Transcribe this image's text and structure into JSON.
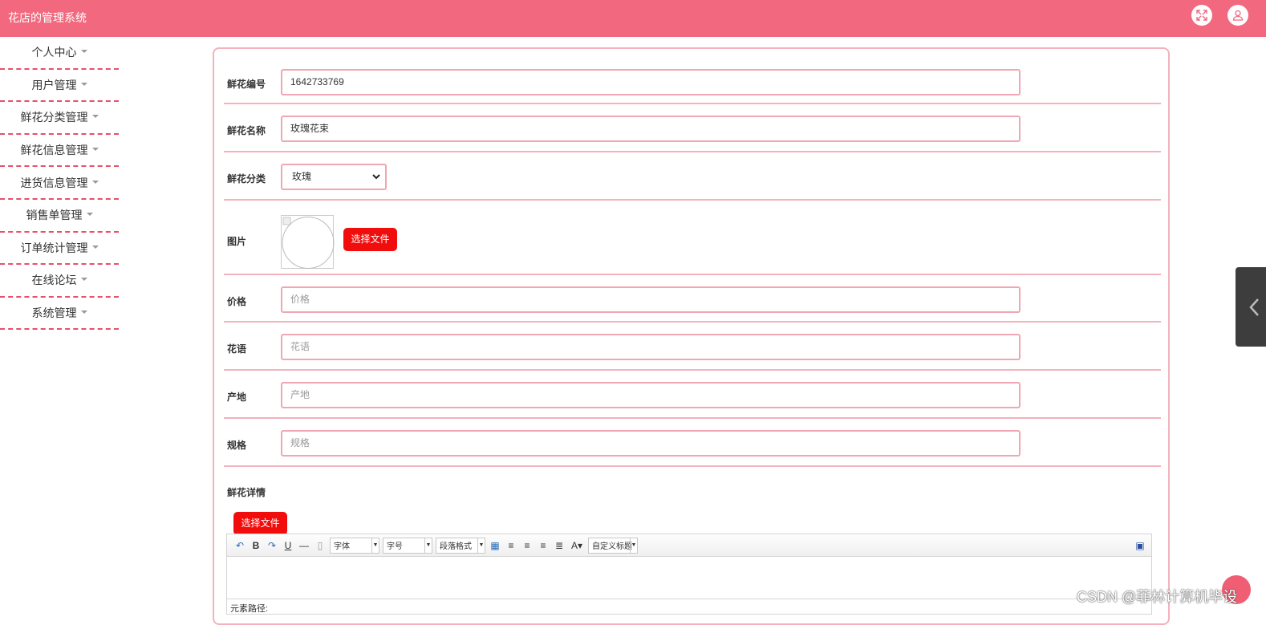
{
  "header": {
    "title": "花店的管理系统",
    "expand_icon": "fullscreen-icon",
    "user_icon": "user-icon"
  },
  "sidebar": {
    "items": [
      {
        "label": "个人中心"
      },
      {
        "label": "用户管理"
      },
      {
        "label": "鲜花分类管理"
      },
      {
        "label": "鲜花信息管理"
      },
      {
        "label": "进货信息管理"
      },
      {
        "label": "销售单管理"
      },
      {
        "label": "订单统计管理"
      },
      {
        "label": "在线论坛"
      },
      {
        "label": "系统管理"
      }
    ]
  },
  "form": {
    "code": {
      "label": "鲜花编号",
      "value": "1642733769"
    },
    "name": {
      "label": "鲜花名称",
      "value": "玫瑰花束"
    },
    "category": {
      "label": "鲜花分类",
      "selected": "玫瑰"
    },
    "image": {
      "label": "图片",
      "button": "选择文件"
    },
    "price": {
      "label": "价格",
      "placeholder": "价格"
    },
    "language": {
      "label": "花语",
      "placeholder": "花语"
    },
    "origin": {
      "label": "产地",
      "placeholder": "产地"
    },
    "spec": {
      "label": "规格",
      "placeholder": "规格"
    },
    "detail": {
      "label": "鲜花详情",
      "button": "选择文件"
    }
  },
  "editor": {
    "font_combo": "字体",
    "size_combo": "字号",
    "paragraph_combo": "段落格式",
    "custom_title_combo": "自定义标题",
    "path_label": "元素路径:"
  },
  "watermark": "CSDN @菲林计算机毕设",
  "colors": {
    "header": "#f2687e",
    "accent_border": "#f0a7b3",
    "button": "#f20d0d"
  }
}
